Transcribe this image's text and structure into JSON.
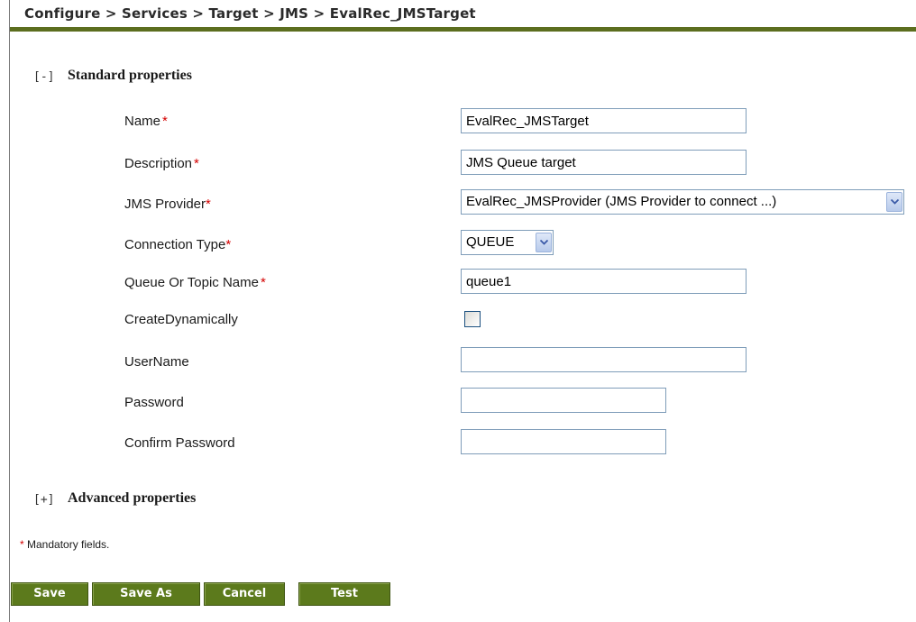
{
  "breadcrumb": {
    "text": "Configure > Services > Target > JMS > EvalRec_JMSTarget"
  },
  "standard": {
    "toggle": "[-]",
    "title": "Standard properties"
  },
  "advanced": {
    "toggle": "[+]",
    "title": "Advanced properties"
  },
  "fields": {
    "name": {
      "label": "Name",
      "required_mark": "*",
      "value": "EvalRec_JMSTarget"
    },
    "description": {
      "label": "Description",
      "required_mark": "*",
      "value": "JMS Queue target"
    },
    "provider": {
      "label": "JMS Provider",
      "required_mark": "*",
      "value": "EvalRec_JMSProvider (JMS Provider to connect ...)"
    },
    "connection_type": {
      "label": "Connection Type",
      "required_mark": "*",
      "value": "QUEUE"
    },
    "queue_topic": {
      "label": "Queue Or Topic Name",
      "required_mark": "*",
      "value": "queue1"
    },
    "create_dynamically": {
      "label": "CreateDynamically",
      "checked": false
    },
    "username": {
      "label": "UserName",
      "value": ""
    },
    "password": {
      "label": "Password",
      "value": ""
    },
    "confirm_password": {
      "label": "Confirm Password",
      "value": ""
    }
  },
  "note": {
    "mark": "*",
    "text": " Mandatory fields."
  },
  "buttons": {
    "save": "Save",
    "save_as": "Save As",
    "cancel": "Cancel",
    "test": "Test"
  },
  "colors": {
    "accent": "#5c6e1f",
    "button": "#5c7a1c",
    "required": "#d40000"
  }
}
